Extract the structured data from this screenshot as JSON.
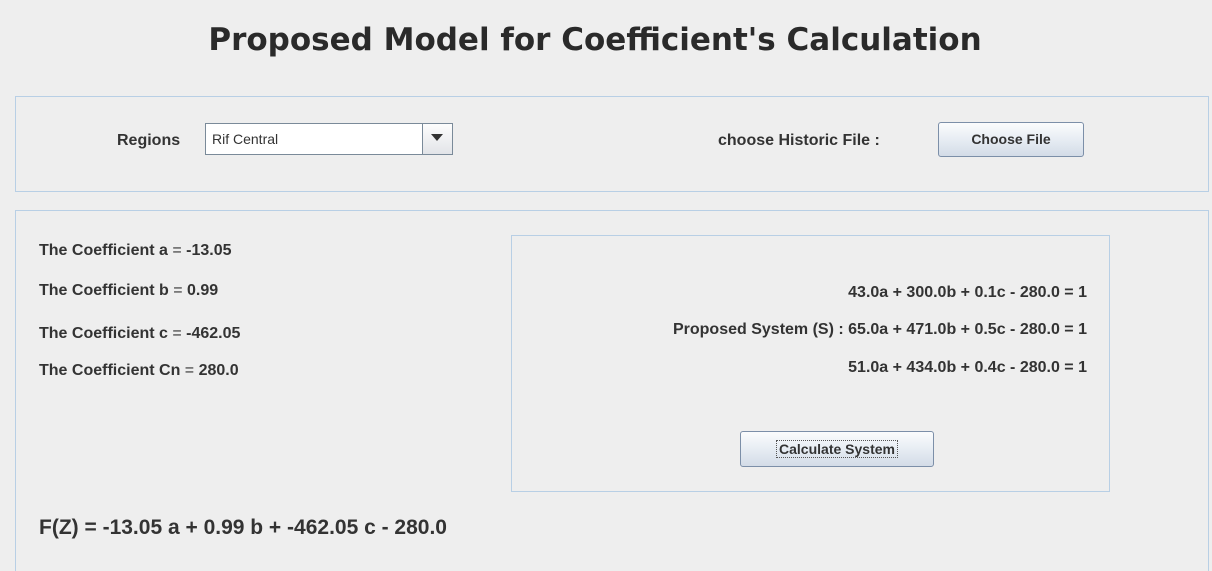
{
  "header": {
    "title": "Proposed Model for Coefficient's Calculation"
  },
  "selection": {
    "regions_label": "Regions",
    "region_value": "Rif Central",
    "historic_label": "choose Historic File :",
    "choose_file_button": "Choose File"
  },
  "coefficients": [
    {
      "label": "The Coefficient a",
      "eq": " = ",
      "value": "-13.05"
    },
    {
      "label": "The Coefficient b",
      "eq": " = ",
      "value": "0.99"
    },
    {
      "label": "The Coefficient c",
      "eq": " = ",
      "value": "-462.05"
    },
    {
      "label": "The Coefficient Cn",
      "eq": " = ",
      "value": "280.0"
    }
  ],
  "system": {
    "label": "Proposed System (S) :",
    "equations": [
      "43.0a + 300.0b + 0.1c - 280.0 = 1",
      "65.0a + 471.0b + 0.5c - 280.0 = 1",
      "51.0a + 434.0b + 0.4c - 280.0 = 1"
    ],
    "calculate_button": "Calculate System"
  },
  "result": {
    "function": "F(Z) = -13.05 a + 0.99 b + -462.05 c - 280.0"
  },
  "colors": {
    "background": "#eeeeee",
    "panel_border": "#b8cfe5",
    "button_border": "#7c8fa8"
  }
}
